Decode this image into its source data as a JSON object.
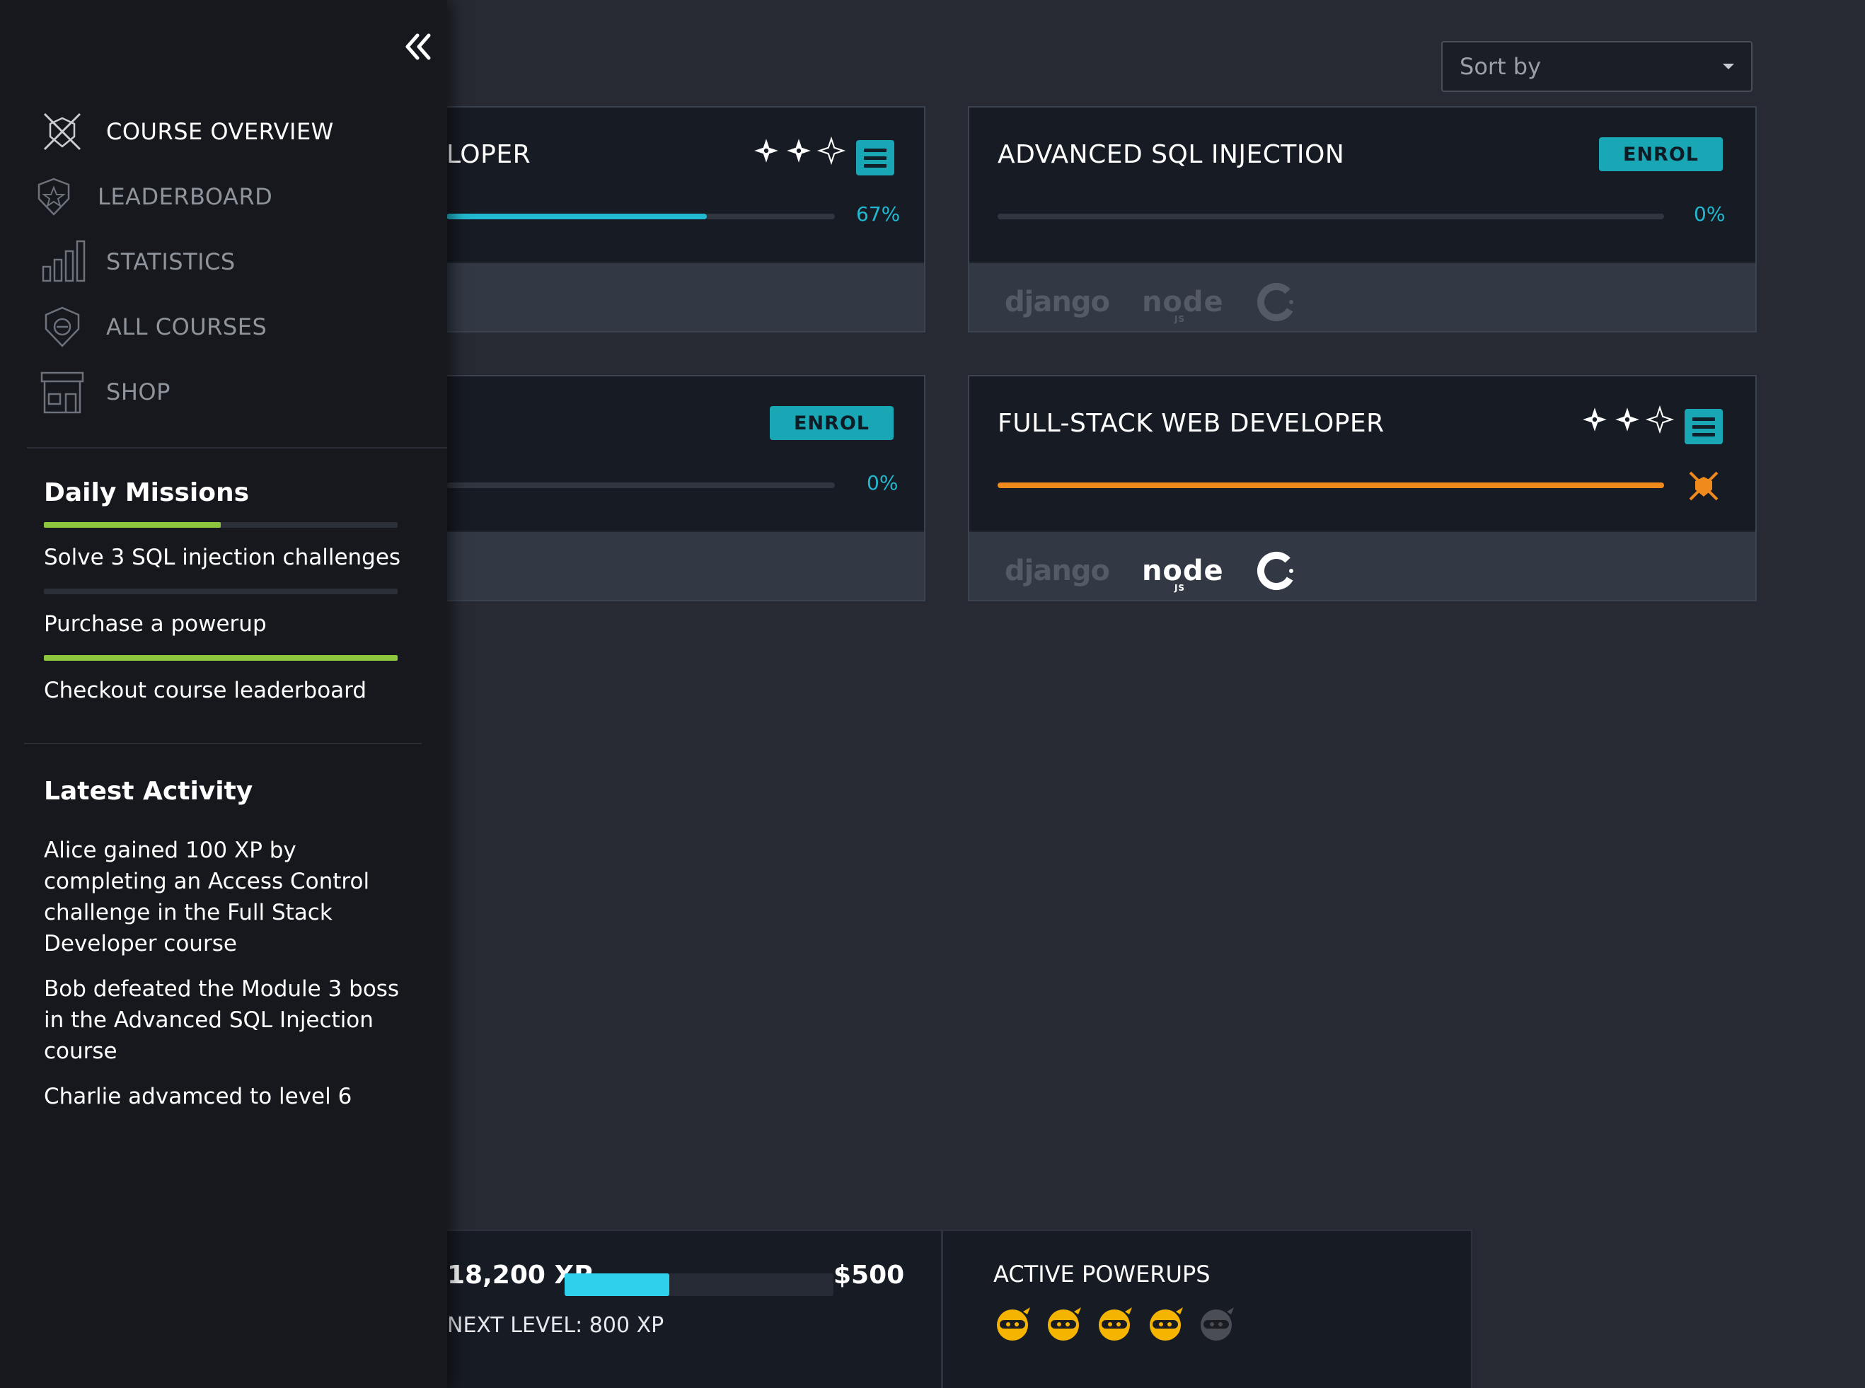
{
  "sort": {
    "label": "Sort by"
  },
  "courses": [
    {
      "title": "FULL-STACK WEB DEVELOPER",
      "visible_title": "LOPER",
      "progress_pct": 67,
      "progress_label": "67%",
      "enrolled": true
    },
    {
      "title": "ADVANCED SQL INJECTION",
      "progress_pct": 0,
      "progress_label": "0%",
      "enrolled": false,
      "enrol_label": "ENROL"
    },
    {
      "title": "",
      "progress_pct": 0,
      "progress_label": "0%",
      "enrolled": false,
      "enrol_label": "ENROL"
    },
    {
      "title": "FULL-STACK WEB DEVELOPER",
      "progress_pct": 100,
      "enrolled": true,
      "complete": true
    }
  ],
  "tech": {
    "django": "django",
    "node": "node",
    "node_sub": "JS"
  },
  "sidebar": {
    "nav": [
      {
        "label": "COURSE OVERVIEW",
        "icon": "crossed-swords-shield-icon",
        "active": true
      },
      {
        "label": "LEADERBOARD",
        "icon": "star-shield-icon",
        "active": false
      },
      {
        "label": "STATISTICS",
        "icon": "bar-chart-icon",
        "active": false
      },
      {
        "label": "ALL COURSES",
        "icon": "course-shield-icon",
        "active": false
      },
      {
        "label": "SHOP",
        "icon": "storefront-icon",
        "active": false
      }
    ],
    "missions_title": "Daily Missions",
    "missions": [
      {
        "label": "Solve 3 SQL injection challenges",
        "progress": 0.5
      },
      {
        "label": "Purchase a powerup",
        "progress": 0
      },
      {
        "label": "Checkout course leaderboard",
        "progress": 1
      }
    ],
    "activity_title": "Latest Activity",
    "activity": [
      "Alice gained 100 XP by completing an Access Control challenge in the  Full Stack Developer course",
      "Bob defeated the Module 3 boss in the Advanced SQL Injection course",
      "Charlie advamced to level 6"
    ]
  },
  "footer": {
    "xp_value": "18,200 XP",
    "xp_progress": 0.39,
    "money": "$500",
    "next_level": "NEXT LEVEL: 800 XP",
    "powerups_title": "ACTIVE POWERUPS",
    "powerups_active": 4,
    "powerups_total": 5
  },
  "colors": {
    "accent": "#1aa7b5",
    "progress_cyan": "#22b8cf",
    "complete_orange": "#f08a1c",
    "mission_green": "#8cc63f",
    "xp_bar": "#2fd1ea",
    "powerup_gold": "#f5b400"
  }
}
